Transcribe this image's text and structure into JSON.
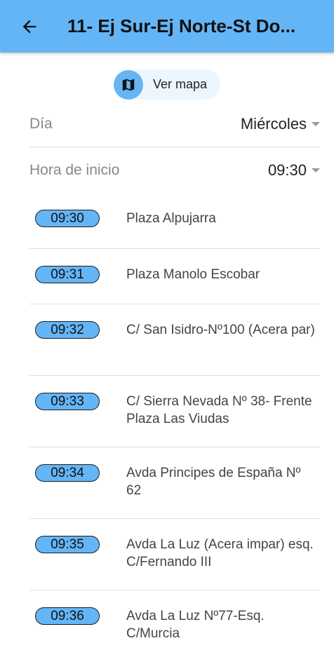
{
  "appbar": {
    "title": "11- Ej Sur-Ej Norte-St Do..."
  },
  "map_button": {
    "label": "Ver mapa"
  },
  "day": {
    "label": "Día",
    "selected": "Miércoles"
  },
  "start_time": {
    "label": "Hora de inicio",
    "selected": "09:30"
  },
  "colors": {
    "primary": "#64b5f6",
    "background": "#ffffff"
  },
  "stops": [
    {
      "time": "09:30",
      "name": "Plaza Alpujarra"
    },
    {
      "time": "09:31",
      "name": "Plaza Manolo Escobar"
    },
    {
      "time": "09:32",
      "name": "C/ San Isidro-Nº100 (Acera par)"
    },
    {
      "time": "09:33",
      "name": "C/ Sierra Nevada Nº 38- Frente Plaza Las Viudas"
    },
    {
      "time": "09:34",
      "name": "Avda Principes de España Nº 62"
    },
    {
      "time": "09:35",
      "name": "Avda La Luz (Acera impar) esq. C/Fernando III"
    },
    {
      "time": "09:36",
      "name": "Avda La Luz Nº77-Esq. C/Murcia"
    }
  ]
}
